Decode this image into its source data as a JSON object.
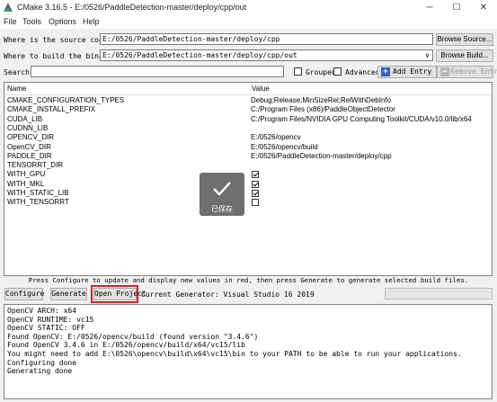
{
  "window": {
    "title": "CMake 3.16.5 - E:/0526/PaddleDetection-master/deploy/cpp/out",
    "min_glyph": "─",
    "max_glyph": "☐",
    "close_glyph": "✕"
  },
  "menu": [
    "File",
    "Tools",
    "Options",
    "Help"
  ],
  "source": {
    "label": "Where is the source code:",
    "value": "E:/0526/PaddleDetection-master/deploy/cpp",
    "browse_label": "Browse Source..."
  },
  "build": {
    "label": "Where to build the binaries:",
    "value": "E:/0526/PaddleDetection-master/deploy/cpp/out",
    "dropdown_glyph": "∨",
    "browse_label": "Browse Build..."
  },
  "search": {
    "label": "Search:",
    "value": "",
    "grouped_label": "Grouped",
    "grouped_checked": false,
    "advanced_label": "Advanced",
    "advanced_checked": false,
    "add_entry_label": "Add Entry",
    "remove_entry_label": "Remove Entry"
  },
  "table": {
    "headers": [
      "Name",
      "Value"
    ],
    "rows": [
      {
        "name": "CMAKE_CONFIGURATION_TYPES",
        "value": "Debug;Release;MinSizeRel;RelWithDebInfo"
      },
      {
        "name": "CMAKE_INSTALL_PREFIX",
        "value": "C:/Program Files (x86)/PaddleObjectDetector"
      },
      {
        "name": "CUDA_LIB",
        "value": "C:/Program Files/NVIDIA GPU Computing Toolkit/CUDA/v10.0/lib/x64"
      },
      {
        "name": "CUDNN_LIB",
        "value": ""
      },
      {
        "name": "OPENCV_DIR",
        "value": "E:/0526/opencv"
      },
      {
        "name": "OpenCV_DIR",
        "value": "E:/0526/opencv/build"
      },
      {
        "name": "PADDLE_DIR",
        "value": "E:/0526/PaddleDetection-master/deploy/cpp"
      },
      {
        "name": "TENSORRT_DIR",
        "value": ""
      },
      {
        "name": "WITH_GPU",
        "checked": true
      },
      {
        "name": "WITH_MKL",
        "checked": true
      },
      {
        "name": "WITH_STATIC_LIB",
        "checked": true
      },
      {
        "name": "WITH_TENSORRT",
        "checked": false
      }
    ]
  },
  "toast": {
    "text": "已保存"
  },
  "status_message": "Press Configure to update and display new values in red, then press Generate to generate selected build files.",
  "actions": {
    "configure_label": "Configure",
    "generate_label": "Generate",
    "open_project_label": "Open Project",
    "current_generator": "Current Generator: Visual Studio 16 2019",
    "highlight_color": "#e02020"
  },
  "output_lines": [
    "OpenCV ARCH: x64",
    "OpenCV RUNTIME: vc15",
    "OpenCV STATIC: OFF",
    "Found OpenCV: E:/0526/opencv/build (found version \"3.4.6\")",
    "Found OpenCV 3.4.6 in E:/0526/opencv/build/x64/vc15/lib",
    "You might need to add E:\\0526\\opencv\\build\\x64\\vc15\\bin to your PATH to be able to run your applications.",
    "Configuring done",
    "Generating done"
  ]
}
